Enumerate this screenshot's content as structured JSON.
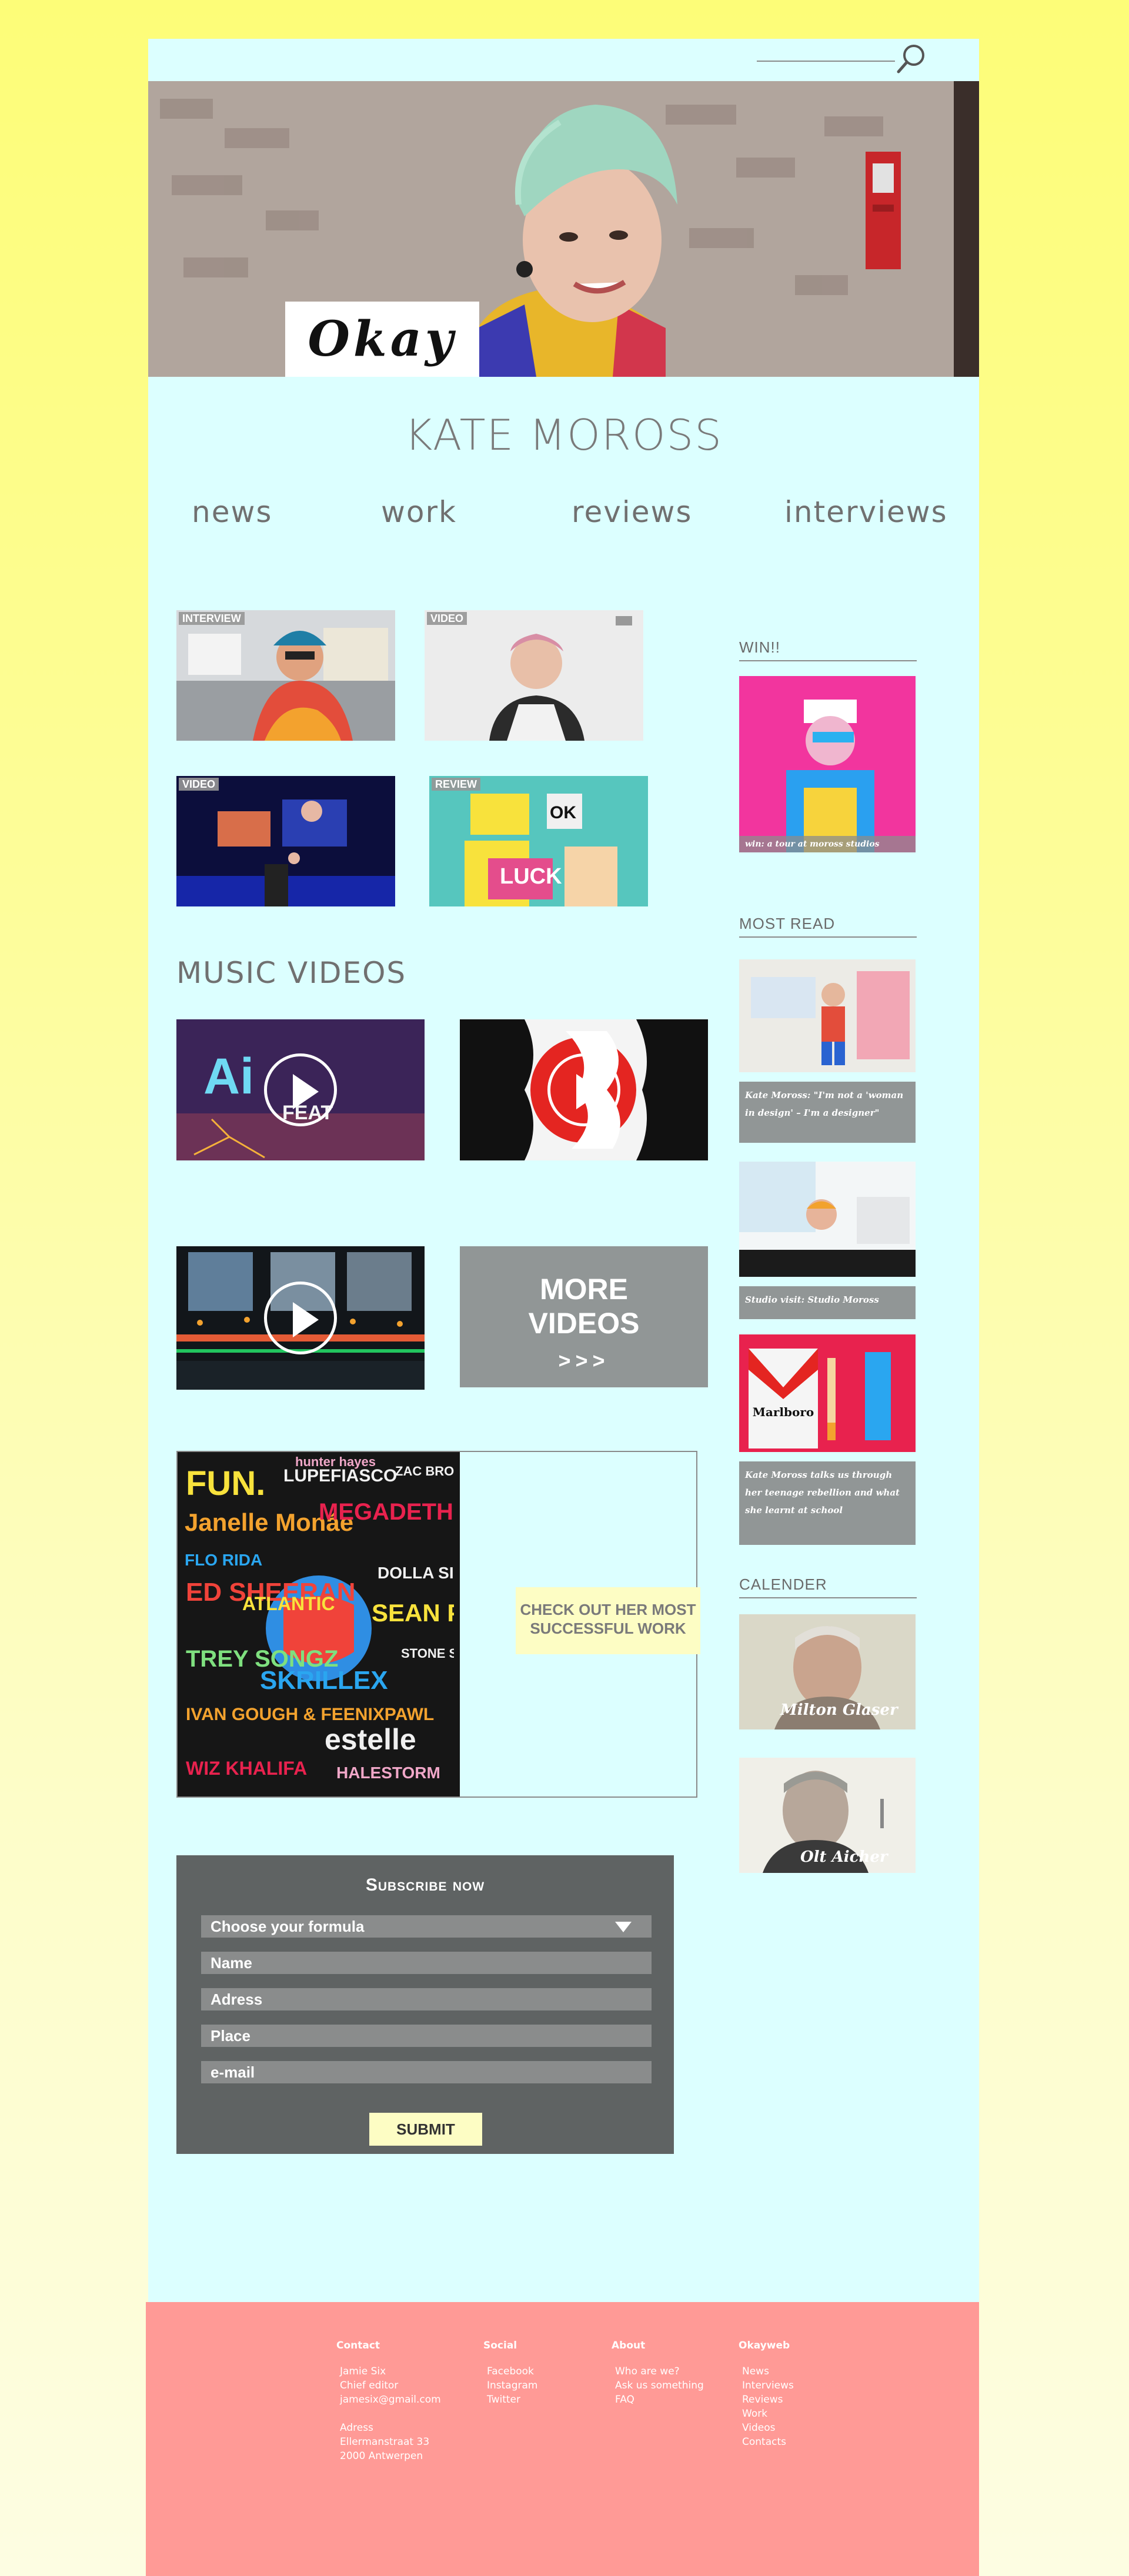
{
  "search": {
    "placeholder": ""
  },
  "hero": {
    "logo_text": "Okay"
  },
  "site_title": "KATE MOROSS",
  "nav": [
    {
      "label": "news"
    },
    {
      "label": "work"
    },
    {
      "label": "reviews"
    },
    {
      "label": "interviews"
    }
  ],
  "news_tiles": [
    {
      "tag": "INTERVIEW"
    },
    {
      "tag": "VIDEO"
    },
    {
      "tag": "VIDEO"
    },
    {
      "tag": "REVIEW",
      "overlay_text": "LUCK"
    }
  ],
  "music_videos": {
    "heading": "MUSIC VIDEOS",
    "video1_text": "Ai",
    "video1_feat": "FEAT",
    "more_label": "MORE VIDEOS",
    "more_arrows": ">>>"
  },
  "feature": {
    "cta": "CHECK OUT HER MOST SUCCESSFUL WORK",
    "art_words": [
      "FUN.",
      "LUPEFIASCO",
      "ZAC BROWN BAND",
      "Janelle Monáe",
      "MEGADETH",
      "FLO RIDA",
      "ED SHEERAN",
      "ATLANTIC",
      "SEAN PAUL",
      "DOLLA SIGN",
      "TREY SONGZ",
      "SKRILLEX",
      "STONE SOUR",
      "IVAN GOUGH & FEENIXPAWL",
      "estelle",
      "WIZ KHALIFA",
      "HALESTORM",
      "hunter hayes"
    ]
  },
  "subscribe": {
    "title": "Subscribe now",
    "formula_label": "Choose your formula",
    "name_placeholder": "Name",
    "address_placeholder": "Adress",
    "place_placeholder": "Place",
    "email_placeholder": "e-mail",
    "submit_label": "SUBMIT"
  },
  "sidebar": {
    "win_heading": "WIN!!",
    "win_caption": "win: a tour at moross studios",
    "most_read_heading": "MOST READ",
    "most_read": [
      {
        "caption": "Kate Moross: \"I'm not a 'woman in design' – I'm a designer\""
      },
      {
        "caption": "Studio visit: Studio Moross"
      },
      {
        "caption": "Kate Moross talks us through her teenage rebellion and what she learnt at school",
        "pack_text": "Marlboro"
      }
    ],
    "calendar_heading": "CALENDER",
    "calendar": [
      {
        "name": "Milton Glaser"
      },
      {
        "name": "Olt Aicher"
      }
    ]
  },
  "footer": {
    "contact": {
      "heading": "Contact",
      "lines": [
        "Jamie Six",
        "Chief editor",
        "jamesix@gmail.com"
      ],
      "address_lines": [
        "Adress",
        "Ellermanstraat 33",
        "2000 Antwerpen"
      ]
    },
    "social": {
      "heading": "Social",
      "links": [
        "Facebook",
        "Instagram",
        "Twitter"
      ]
    },
    "about": {
      "heading": "About",
      "links": [
        "Who are we?",
        "Ask us something",
        "FAQ"
      ]
    },
    "okayweb": {
      "heading": "Okayweb",
      "links": [
        "News",
        "Interviews",
        "Reviews",
        "Work",
        "Videos",
        "Contacts"
      ]
    }
  }
}
